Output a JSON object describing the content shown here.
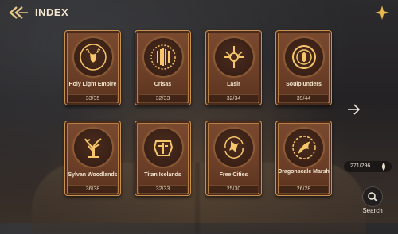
{
  "header": {
    "title": "INDEX",
    "back_icon": "double-chevron-left-icon",
    "menu_icon": "sparkle-icon"
  },
  "colors": {
    "card_bg": "#6a3e27",
    "card_border": "#c9904f",
    "emblem_glow": "#f7c66b",
    "text_light": "#f5e8d2"
  },
  "factions": [
    {
      "name": "Holy Light Empire",
      "count": "33/35",
      "icon": "deer-icon"
    },
    {
      "name": "Crisas",
      "count": "32/33",
      "icon": "claw-marks-icon"
    },
    {
      "name": "Lasir",
      "count": "32/34",
      "icon": "winged-orb-icon"
    },
    {
      "name": "Soulplunders",
      "count": "39/44",
      "icon": "vortex-eye-icon"
    },
    {
      "name": "Sylvan Woodlands",
      "count": "36/38",
      "icon": "tree-icon"
    },
    {
      "name": "Titan Icelands",
      "count": "32/33",
      "icon": "helmet-icon"
    },
    {
      "name": "Free Cities",
      "count": "25/30",
      "icon": "bird-icon"
    },
    {
      "name": "Dragonscale Marsh",
      "count": "26/28",
      "icon": "dragon-icon"
    }
  ],
  "progress": {
    "text": "271/296",
    "icon": "soul-drop-icon"
  },
  "search": {
    "label": "Search",
    "icon": "search-icon"
  },
  "next_icon": "arrow-right-icon"
}
